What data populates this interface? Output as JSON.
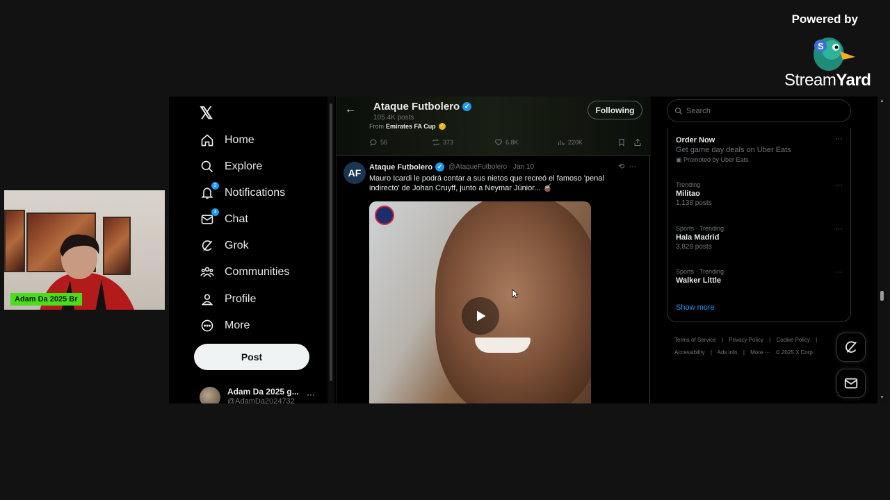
{
  "branding": {
    "powered_by": "Powered by",
    "name_light": "Stream",
    "name_bold": "Yard"
  },
  "webcam": {
    "name_tag": "Adam Da 2025 Br"
  },
  "nav": {
    "logo": "𝕏",
    "items": [
      {
        "label": "Home",
        "icon": "home-icon"
      },
      {
        "label": "Explore",
        "icon": "search-icon"
      },
      {
        "label": "Notifications",
        "icon": "bell-icon",
        "badge": "2"
      },
      {
        "label": "Chat",
        "icon": "mail-icon",
        "badge": "3"
      },
      {
        "label": "Grok",
        "icon": "grok-icon"
      },
      {
        "label": "Communities",
        "icon": "communities-icon"
      },
      {
        "label": "Profile",
        "icon": "person-icon"
      },
      {
        "label": "More",
        "icon": "more-circle-icon"
      }
    ],
    "post_label": "Post",
    "account": {
      "name": "Adam Da 2025 g...",
      "handle": "@AdamDa2024732",
      "dots": "···"
    }
  },
  "feed": {
    "back": "←",
    "profile_name": "Ataque Futbolero",
    "posts_count": "105.4K posts",
    "from_label": "From",
    "from_source": "Emirates FA Cup",
    "following_label": "Following",
    "actions": {
      "replies": "56",
      "reposts": "373",
      "likes": "6.8K",
      "views": "220K"
    },
    "tweet": {
      "avatar_text": "AF",
      "author": "Ataque Futbolero",
      "meta": "@AtaqueFutbolero · Jan 10",
      "text": "Mauro Icardi le podrá contar a sus nietos que recreó el famoso 'penal indirecto' de Johan Cruyff, junto a Neymar Júnior... 🧉",
      "more": "···"
    }
  },
  "sidebar": {
    "search_placeholder": "Search",
    "trends": [
      {
        "context": "",
        "title": "Order Now",
        "sub": "Get game day deals on Uber Eats",
        "promo": "Promoted by Uber Eats"
      },
      {
        "context": "Trending",
        "title": "Militao",
        "sub": "1,138 posts"
      },
      {
        "context": "Sports · Trending",
        "title": "Hala Madrid",
        "sub": "3,828 posts"
      },
      {
        "context": "Sports · Trending",
        "title": "Walker Little",
        "sub": ""
      }
    ],
    "more_dots": "···",
    "show_more": "Show more",
    "footer_line1": [
      "Terms of Service",
      "|",
      "Privacy Policy",
      "|",
      "Cookie Policy",
      "|"
    ],
    "footer_line2": [
      "Accessibility",
      "|",
      "Ads info",
      "|",
      "More ···",
      "© 2025 X Corp."
    ]
  }
}
